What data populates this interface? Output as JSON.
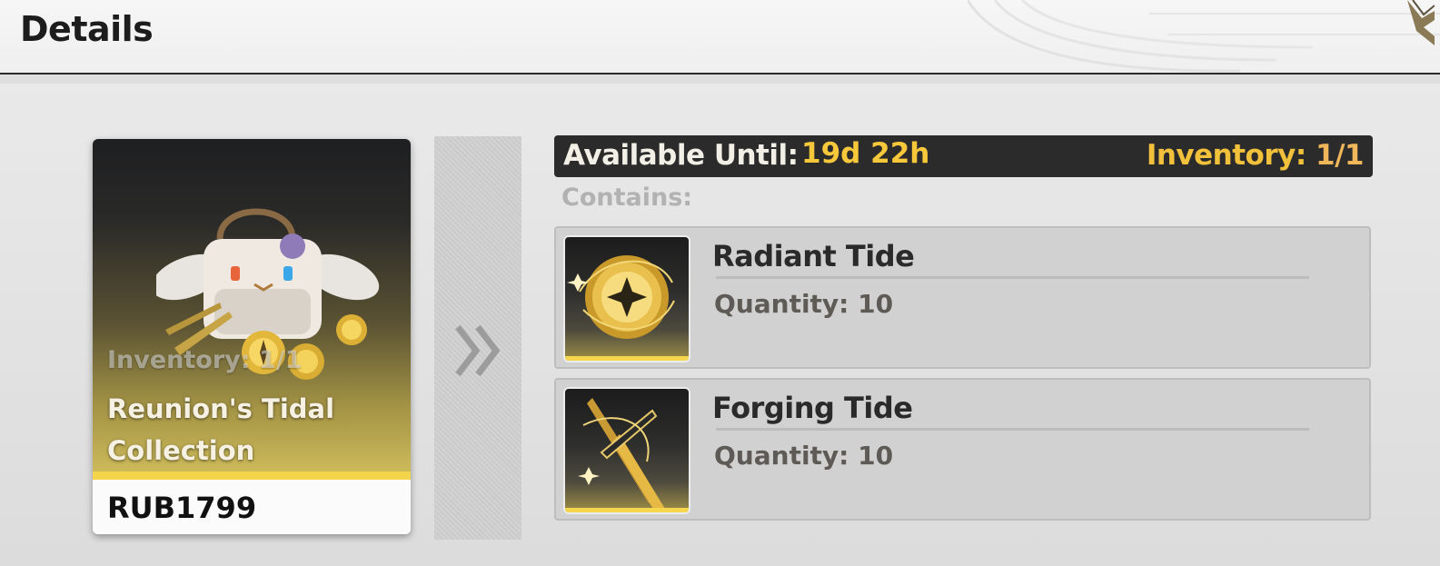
{
  "header": {
    "title": "Details",
    "close_icon": "close-chevron-icon"
  },
  "package": {
    "inventory": "Inventory: 1/1",
    "name": "Reunion's Tidal Collection",
    "price": "RUB1799",
    "accent_color": "#f3d44b"
  },
  "info_bar": {
    "available_label": "Available Until:",
    "available_value": "19d 22h",
    "inventory_label": "Inventory:",
    "inventory_value": "1/1"
  },
  "contains_label": "Contains:",
  "items": [
    {
      "name": "Radiant Tide",
      "quantity": "Quantity: 10",
      "icon": "radiant-tide-orb-icon"
    },
    {
      "name": "Forging Tide",
      "quantity": "Quantity: 10",
      "icon": "forging-tide-blade-icon"
    }
  ],
  "colors": {
    "highlight_yellow": "#f7c83a",
    "info_bar_bg": "#2c2b2c"
  }
}
